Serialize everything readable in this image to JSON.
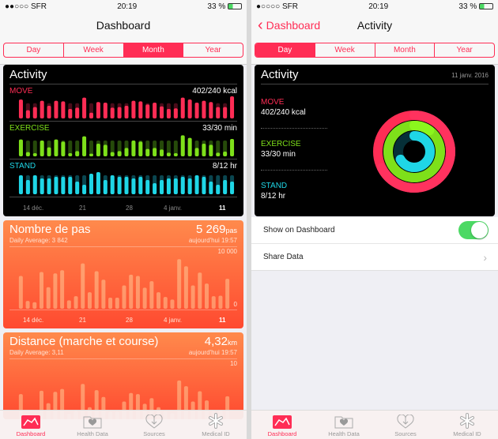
{
  "status": {
    "carrier": "SFR",
    "time": "20:19",
    "battery": "33 %"
  },
  "left": {
    "title": "Dashboard",
    "segments": [
      "Day",
      "Week",
      "Month",
      "Year"
    ],
    "selected": "Month",
    "activity": {
      "title": "Activity",
      "move_label": "MOVE",
      "move_value": "402/240 kcal",
      "exercise_label": "EXERCISE",
      "exercise_value": "33/30 min",
      "stand_label": "STAND",
      "stand_value": "8/12 hr",
      "x_ticks": [
        "14 déc.",
        "21",
        "28",
        "4 janv.",
        "11"
      ]
    },
    "steps": {
      "title": "Nombre de pas",
      "daily_avg": "Daily Average: 3 842",
      "value": "5 269",
      "unit": "pas",
      "time": "aujourd'hui 19:57",
      "y_max": "10 000",
      "y_min": "0",
      "x_ticks": [
        "14 déc.",
        "21",
        "28",
        "4 janv.",
        "11"
      ]
    },
    "distance": {
      "title": "Distance (marche et course)",
      "daily_avg": "Daily Average: 3,11",
      "value": "4,32",
      "unit": "km",
      "time": "aujourd'hui 19:57",
      "y_max": "10"
    }
  },
  "right": {
    "back": "Dashboard",
    "title": "Activity",
    "segments": [
      "Day",
      "Week",
      "Month",
      "Year"
    ],
    "selected": "Day",
    "activity": {
      "title": "Activity",
      "date": "11 janv. 2016",
      "move_label": "MOVE",
      "move_value": "402/240 kcal",
      "exercise_label": "EXERCISE",
      "exercise_value": "33/30 min",
      "stand_label": "STAND",
      "stand_value": "8/12 hr"
    },
    "show_on_dashboard": "Show on Dashboard",
    "show_on_dashboard_on": true,
    "share_data": "Share Data"
  },
  "tabs": [
    "Dashboard",
    "Health Data",
    "Sources",
    "Medical ID"
  ],
  "colors": {
    "accent": "#ff2d55",
    "move": "#ff2d55",
    "exercise": "#7ee01a",
    "stand": "#1fd6e6",
    "toggle": "#4cd964"
  },
  "chart_data": [
    {
      "type": "bar",
      "name_ref": "move",
      "unit": "kcal",
      "goal": 240,
      "values": [
        300,
        130,
        180,
        280,
        200,
        280,
        270,
        150,
        170,
        330,
        90,
        260,
        250,
        170,
        180,
        200,
        280,
        270,
        220,
        250,
        190,
        150,
        160,
        330,
        300,
        250,
        280,
        260,
        180,
        180,
        402
      ]
    },
    {
      "type": "bar",
      "name_ref": "exercise",
      "unit": "min",
      "goal": 30,
      "values": [
        32,
        8,
        6,
        30,
        17,
        32,
        28,
        6,
        10,
        38,
        5,
        24,
        22,
        8,
        10,
        16,
        30,
        28,
        14,
        16,
        13,
        7,
        6,
        40,
        35,
        16,
        24,
        22,
        7,
        9,
        33
      ]
    },
    {
      "type": "bar",
      "name_ref": "stand",
      "unit": "hr",
      "goal": 12,
      "values": [
        12,
        9,
        12,
        10,
        10,
        11,
        11,
        11,
        8,
        6,
        13,
        14,
        9,
        12,
        11,
        11,
        10,
        11,
        9,
        7,
        9,
        10,
        10,
        11,
        10,
        12,
        11,
        8,
        6,
        9,
        8
      ]
    },
    {
      "type": "bar",
      "name_ref": "steps",
      "ylim": [
        0,
        10000
      ],
      "values": [
        5760,
        1380,
        1150,
        6450,
        3780,
        6220,
        6770,
        1470,
        2210,
        7970,
        2900,
        6590,
        5110,
        1940,
        1940,
        4100,
        5990,
        5760,
        3690,
        4840,
        2900,
        2070,
        1610,
        8710,
        7470,
        4100,
        6360,
        4420,
        2210,
        2300,
        5269
      ]
    },
    {
      "type": "bar",
      "name_ref": "distance",
      "ylim": [
        0,
        10
      ],
      "values": [
        4.7,
        1.1,
        0.9,
        5.3,
        3.1,
        5.1,
        5.6,
        1.2,
        1.8,
        6.5,
        2.4,
        5.4,
        4.2,
        1.6,
        1.6,
        3.4,
        4.9,
        4.7,
        3.0,
        4.0,
        2.4,
        1.7,
        1.3,
        7.1,
        6.1,
        3.4,
        5.2,
        3.6,
        1.8,
        1.9,
        4.32
      ]
    },
    {
      "type": "rings",
      "move": 1.675,
      "exercise": 1.1,
      "stand": 0.667
    }
  ]
}
